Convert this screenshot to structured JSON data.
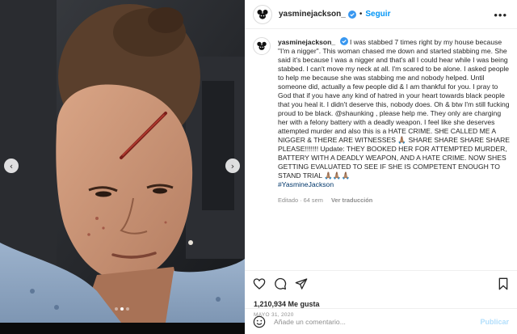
{
  "post": {
    "username": "yasminejackson_",
    "separator": "•",
    "follow_label": "Seguir",
    "more_label": "•••",
    "caption": "I was stabbed 7 times right by my house because \"I'm a nigger\". This woman chased me down and started stabbing me. She said it's because I was a nigger and that's all I could hear while I was being stabbed. I can't move my neck at all. I'm scared to be alone. I asked people to help me because she was stabbing me and nobody helped. Until someone did, actually a few people did & I am thankful for you. I pray to God that if you have any kind of hatred in your heart towards black people that you heal it. I didn't deserve this, nobody does. Oh & btw I'm still fucking proud to be black. @shaunking , please help me. They only are charging her with a felony battery with a deadly weapon. I feel like she deserves attempted murder and also this is a HATE CRIME. SHE CALLED ME A NIGGER & THERE ARE WITNESSES 🙏🏽 SHARE SHARE SHARE SHARE PLEASE!!!!!!! Update: THEY BOOKED HER FOR ATTEMPTED MURDER, BATTERY WITH A DEADLY WEAPON, AND A HATE CRIME. NOW SHES GETTING EVALUATED TO SEE IF SHE IS COMPETENT ENOUGH TO STAND TRIAL 🙏🏽🙏🏽🙏🏽",
    "hashtag": "#YasmineJackson",
    "edited": "Editado · 64 sem",
    "translate_label": "Ver traducción",
    "likes": "1,210,934 Me gusta",
    "date": "MAYO 31, 2020",
    "comment_placeholder": "Añade un comentario...",
    "publish_label": "Publicar"
  },
  "carousel": {
    "prev_label": "‹",
    "next_label": "›",
    "slide_count": 3,
    "active_slide": 1
  },
  "colors": {
    "accent": "#0095f6",
    "verified": "#3897f0",
    "publish_disabled": "#b2dffc"
  }
}
